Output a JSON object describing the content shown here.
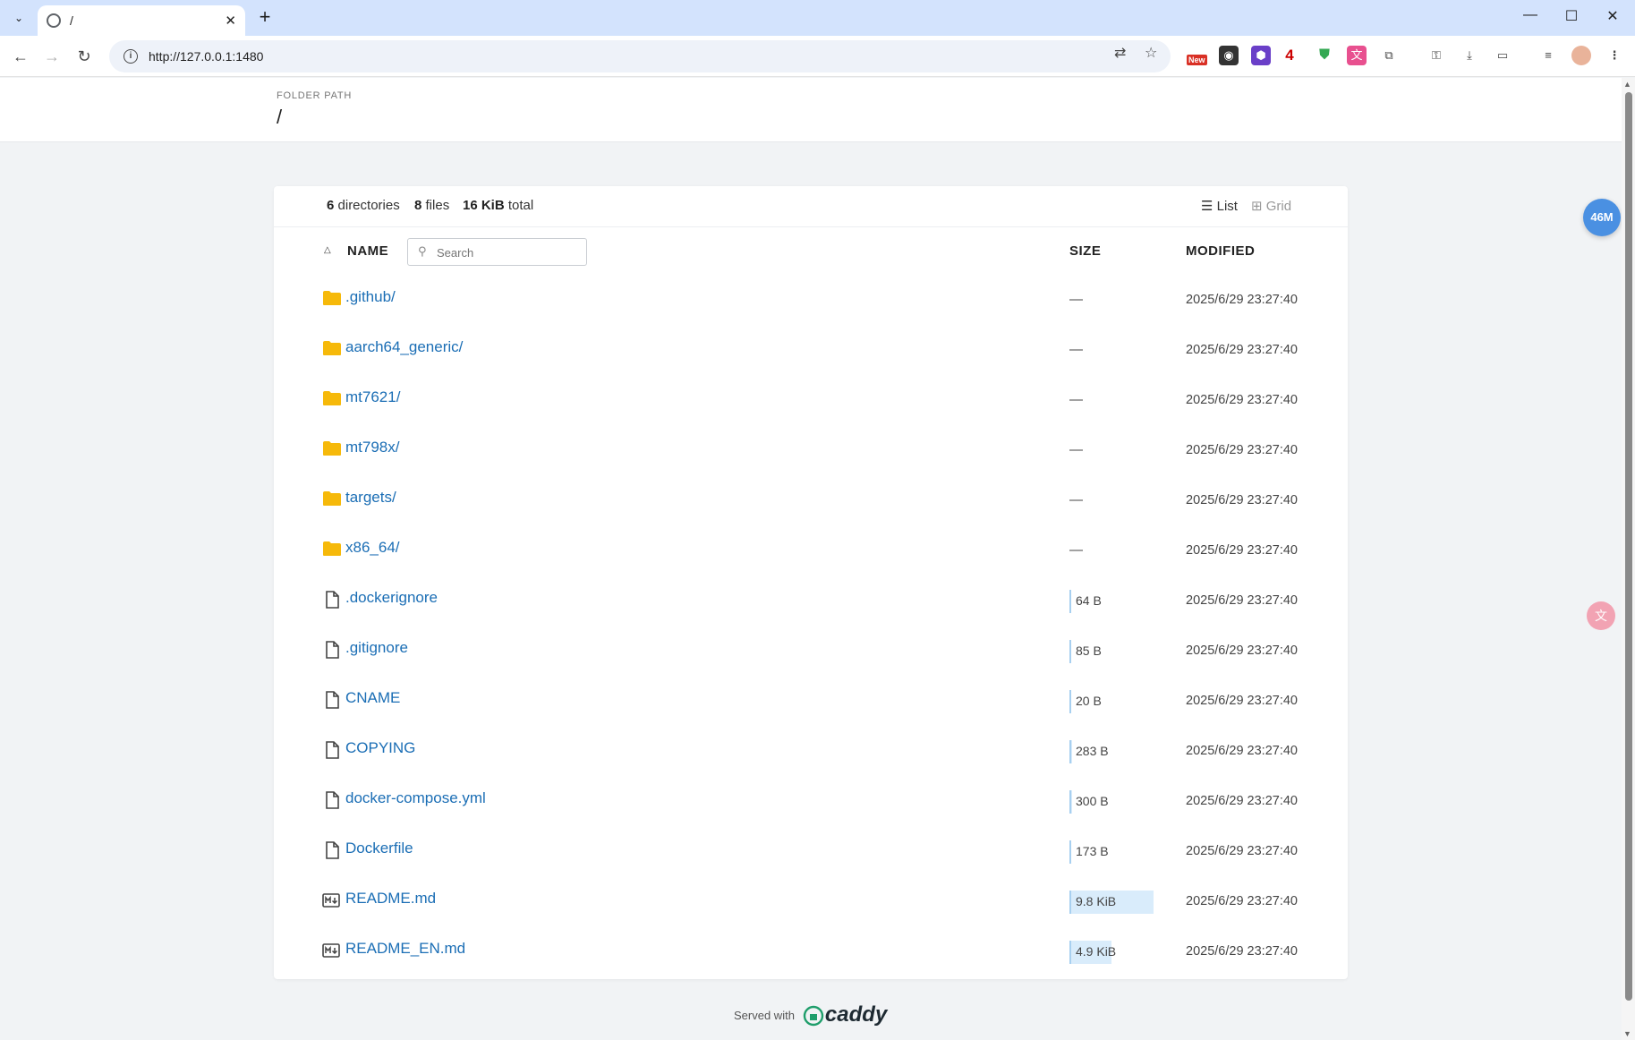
{
  "browser": {
    "tab_title": "/",
    "url": "http://127.0.0.1:1480",
    "new_tab": "+",
    "ext_badge_new": "New",
    "ext_count": "4"
  },
  "header": {
    "label": "FOLDER PATH",
    "path": "/"
  },
  "summary": {
    "dirs_count": "6",
    "dirs_label": "directories",
    "files_count": "8",
    "files_label": "files",
    "total_size": "16 KiB",
    "total_label": "total",
    "view_list": "List",
    "view_grid": "Grid"
  },
  "table": {
    "col_name": "NAME",
    "col_size": "SIZE",
    "col_modified": "MODIFIED",
    "search_placeholder": "Search"
  },
  "rows": [
    {
      "name": ".github/",
      "type": "folder",
      "size": "—",
      "modified": "2025/6/29 23:27:40"
    },
    {
      "name": "aarch64_generic/",
      "type": "folder",
      "size": "—",
      "modified": "2025/6/29 23:27:40"
    },
    {
      "name": "mt7621/",
      "type": "folder",
      "size": "—",
      "modified": "2025/6/29 23:27:40"
    },
    {
      "name": "mt798x/",
      "type": "folder",
      "size": "—",
      "modified": "2025/6/29 23:27:40"
    },
    {
      "name": "targets/",
      "type": "folder",
      "size": "—",
      "modified": "2025/6/29 23:27:40"
    },
    {
      "name": "x86_64/",
      "type": "folder",
      "size": "—",
      "modified": "2025/6/29 23:27:40"
    },
    {
      "name": ".dockerignore",
      "type": "file",
      "size": "64 B",
      "size_fraction": 0.006,
      "modified": "2025/6/29 23:27:40"
    },
    {
      "name": ".gitignore",
      "type": "file",
      "size": "85 B",
      "size_fraction": 0.008,
      "modified": "2025/6/29 23:27:40"
    },
    {
      "name": "CNAME",
      "type": "file",
      "size": "20 B",
      "size_fraction": 0.002,
      "modified": "2025/6/29 23:27:40"
    },
    {
      "name": "COPYING",
      "type": "file",
      "size": "283 B",
      "size_fraction": 0.028,
      "modified": "2025/6/29 23:27:40"
    },
    {
      "name": "docker-compose.yml",
      "type": "file",
      "size": "300 B",
      "size_fraction": 0.03,
      "modified": "2025/6/29 23:27:40"
    },
    {
      "name": "Dockerfile",
      "type": "file",
      "size": "173 B",
      "size_fraction": 0.017,
      "modified": "2025/6/29 23:27:40"
    },
    {
      "name": "README.md",
      "type": "markdown",
      "size": "9.8 KiB",
      "size_fraction": 1.0,
      "modified": "2025/6/29 23:27:40"
    },
    {
      "name": "README_EN.md",
      "type": "markdown",
      "size": "4.9 KiB",
      "size_fraction": 0.5,
      "modified": "2025/6/29 23:27:40"
    }
  ],
  "footer": {
    "served_with": "Served with",
    "brand": "caddy"
  },
  "floating": {
    "badge": "46M"
  },
  "colors": {
    "link": "#1b6eb5",
    "folder": "#f6b90a",
    "size_bar": "#d9ecfb",
    "badge": "#4a90e2"
  }
}
